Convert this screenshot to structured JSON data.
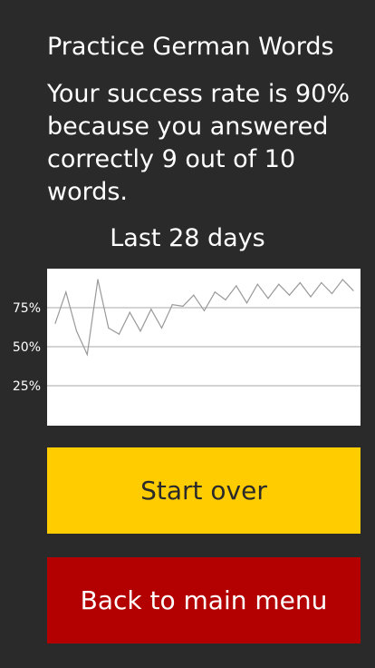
{
  "header": {
    "title": "Practice German Words"
  },
  "result": {
    "text": "Your success rate is 90% because you answered correctly 9 out of 10 words."
  },
  "chart_caption": "Last 28 days",
  "chart_data": {
    "type": "line",
    "title": "Last 28 days",
    "xlabel": "",
    "ylabel": "",
    "ylim": [
      0,
      100
    ],
    "y_ticks": [
      "25%",
      "50%",
      "75%"
    ],
    "y_tick_values": [
      25,
      50,
      75
    ],
    "grid": true,
    "line_color": "#999999",
    "background": "#ffffff",
    "values": [
      65,
      85,
      60,
      45,
      93,
      62,
      58,
      72,
      60,
      74,
      62,
      77,
      76,
      83,
      73,
      85,
      80,
      89,
      78,
      90,
      81,
      90,
      83,
      91,
      82,
      91,
      84,
      93,
      86
    ]
  },
  "buttons": {
    "start_over": "Start over",
    "back_to_menu": "Back to main menu"
  },
  "colors": {
    "background": "#2a2a2a",
    "start_button": "#ffcc00",
    "back_button": "#b30000"
  }
}
